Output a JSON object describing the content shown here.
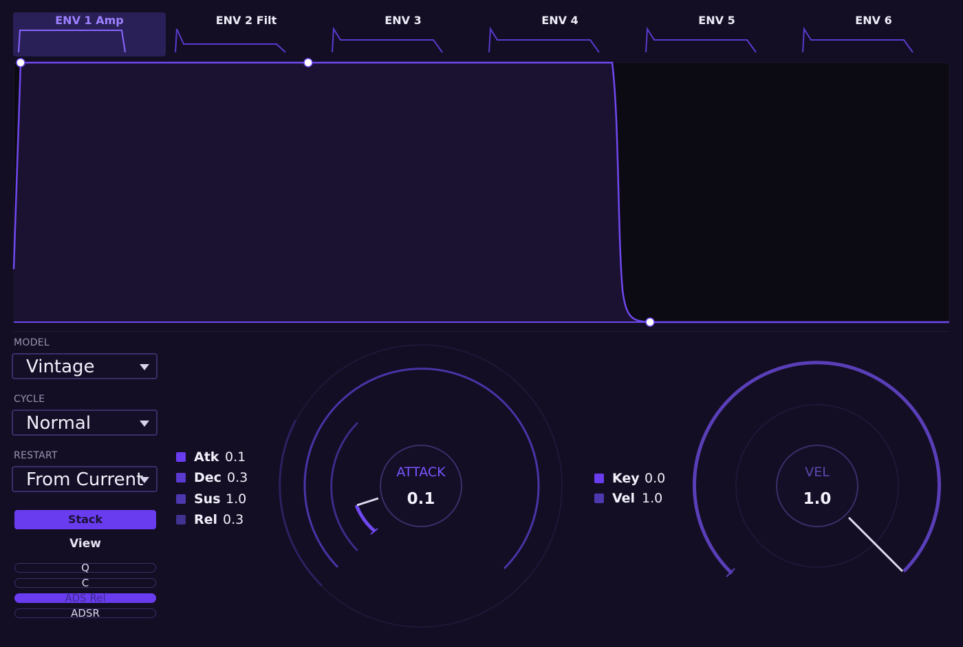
{
  "tabs": [
    {
      "label": "ENV 1 Amp",
      "active": true
    },
    {
      "label": "ENV 2 Filt",
      "active": false
    },
    {
      "label": "ENV 3",
      "active": false
    },
    {
      "label": "ENV 4",
      "active": false
    },
    {
      "label": "ENV 5",
      "active": false
    },
    {
      "label": "ENV 6",
      "active": false
    }
  ],
  "model": {
    "label": "MODEL",
    "value": "Vintage"
  },
  "cycle": {
    "label": "CYCLE",
    "value": "Normal"
  },
  "restart": {
    "label": "RESTART",
    "value": "From Current"
  },
  "stack_button": "Stack",
  "view": {
    "label": "View",
    "options": [
      {
        "label": "Q",
        "active": false
      },
      {
        "label": "C",
        "active": false
      },
      {
        "label": "ADS Rel",
        "active": true
      },
      {
        "label": "ADSR",
        "active": false
      }
    ]
  },
  "params": [
    {
      "name": "Atk",
      "value": "0.1",
      "color": "#6a3cf0"
    },
    {
      "name": "Dec",
      "value": "0.3",
      "color": "#5a3ad0"
    },
    {
      "name": "Sus",
      "value": "1.0",
      "color": "#4e38b0"
    },
    {
      "name": "Rel",
      "value": "0.3",
      "color": "#3f3290"
    }
  ],
  "attack_knob": {
    "label": "ATTACK",
    "value": "0.1",
    "label_color": "#7a55ff",
    "level": 0.06
  },
  "mods": [
    {
      "name": "Key",
      "value": "0.0",
      "color": "#6a3cf0"
    },
    {
      "name": "Vel",
      "value": "1.0",
      "color": "#4e38b0"
    }
  ],
  "vel_knob": {
    "label": "VEL",
    "value": "1.0",
    "label_color": "#5a4ab0",
    "level": 1.0
  },
  "colors": {
    "accent": "#6a3cf0",
    "line": "#7048f0",
    "bg": "#130e23"
  }
}
